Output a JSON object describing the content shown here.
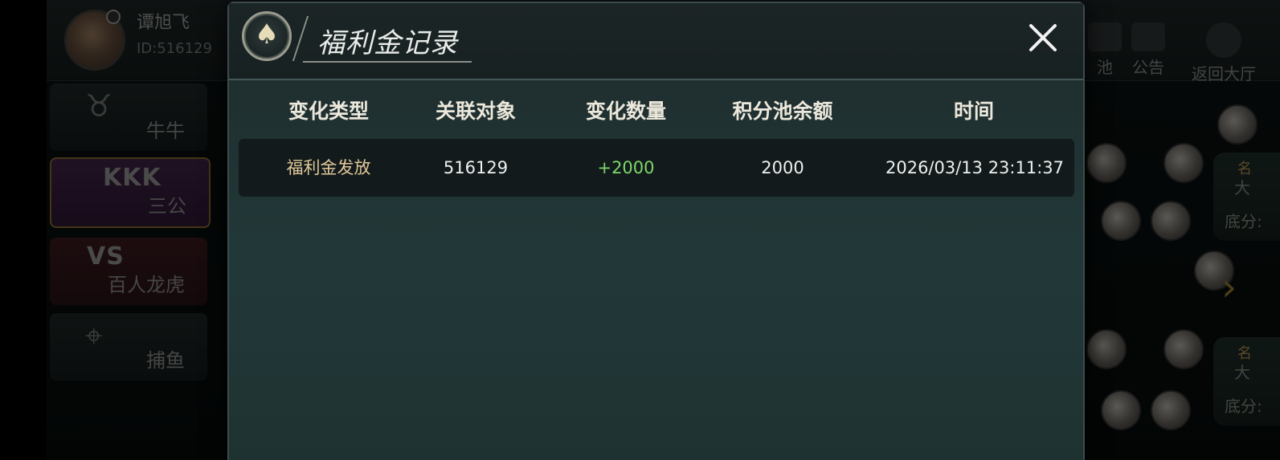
{
  "background": {
    "user": {
      "name": "谭旭飞",
      "id_label": "ID:516129"
    },
    "side_menu": [
      {
        "big": "",
        "label": "牛牛",
        "glyph": "bull-icon",
        "active": false
      },
      {
        "big": "KKK",
        "label": "三公",
        "glyph": "",
        "active": true
      },
      {
        "big": "VS",
        "label": "百人龙虎",
        "glyph": "",
        "active": false
      },
      {
        "big": "",
        "label": "捕鱼",
        "glyph": "crosshair-icon",
        "active": false
      }
    ],
    "top_right": [
      {
        "label": "池",
        "icon": "pool-icon"
      },
      {
        "label": "公告",
        "icon": "notice-icon"
      },
      {
        "label": "返回大厅",
        "icon": "back-arrow-icon"
      }
    ],
    "right_cards": [
      {
        "a": "名",
        "b": "大",
        "c": "底分:"
      },
      {
        "a": "名",
        "b": "大",
        "c": "底分:"
      }
    ]
  },
  "modal": {
    "title": "福利金记录",
    "badge_icon": "spade-icon",
    "close_icon": "close-icon",
    "columns": [
      "变化类型",
      "关联对象",
      "变化数量",
      "积分池余额",
      "时间"
    ],
    "rows": [
      {
        "type": "福利金发放",
        "target": "516129",
        "amount": "+2000",
        "balance": "2000",
        "time": "2026/03/13 23:11:37"
      }
    ]
  },
  "colors": {
    "positive_amount": "#7fd66b",
    "type_text": "#e2c89a",
    "header_text": "#ece8dc"
  }
}
